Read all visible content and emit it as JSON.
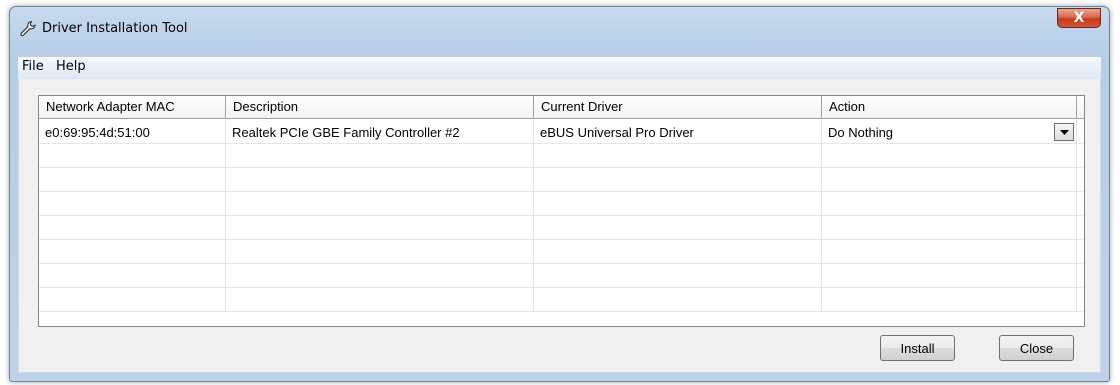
{
  "window": {
    "title": "Driver Installation Tool",
    "close_label": "X"
  },
  "menu": {
    "items": [
      {
        "label": "File"
      },
      {
        "label": "Help"
      }
    ]
  },
  "table": {
    "columns": [
      "Network Adapter MAC",
      "Description",
      "Current Driver",
      "Action"
    ],
    "rows": [
      {
        "mac": "e0:69:95:4d:51:00",
        "description": "Realtek PCIe GBE Family Controller #2",
        "driver": "eBUS Universal Pro Driver",
        "action": "Do Nothing"
      }
    ]
  },
  "buttons": {
    "install": "Install",
    "close": "Close"
  }
}
